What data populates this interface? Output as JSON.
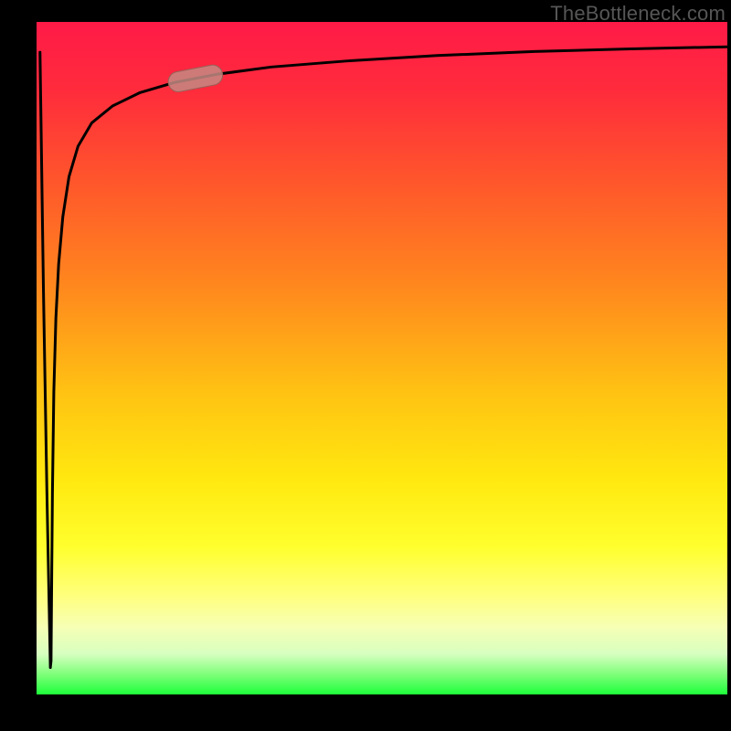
{
  "attribution": "TheBottleneck.com",
  "colors": {
    "frame": "#000000",
    "gradient_top": "#ff1a47",
    "gradient_mid1": "#ff8a1d",
    "gradient_mid2": "#ffff2d",
    "gradient_bottom": "#1eff3a",
    "curve": "#000000",
    "highlight_fill": "#c48a82",
    "highlight_stroke": "#9a5f57"
  },
  "chart_data": {
    "type": "line",
    "title": "",
    "xlabel": "",
    "ylabel": "",
    "xlim": [
      0,
      100
    ],
    "ylim": [
      0,
      100
    ],
    "x": [
      0.5,
      1.0,
      1.5,
      2.0,
      2.1,
      2.2,
      2.3,
      2.5,
      2.8,
      3.2,
      3.8,
      4.7,
      6.0,
      8.0,
      11.0,
      15.0,
      20.0,
      26.0,
      34.0,
      45.0,
      58.0,
      72.0,
      86.0,
      100.0
    ],
    "values": [
      95.5,
      60.0,
      30.0,
      4.0,
      5.0,
      18.0,
      30.0,
      45.0,
      56.0,
      64.0,
      71.0,
      77.0,
      81.5,
      85.0,
      87.5,
      89.5,
      91.0,
      92.2,
      93.3,
      94.2,
      95.0,
      95.6,
      96.0,
      96.3
    ],
    "highlight_segment": {
      "x_start": 20.0,
      "x_end": 26.0
    },
    "annotations": []
  }
}
